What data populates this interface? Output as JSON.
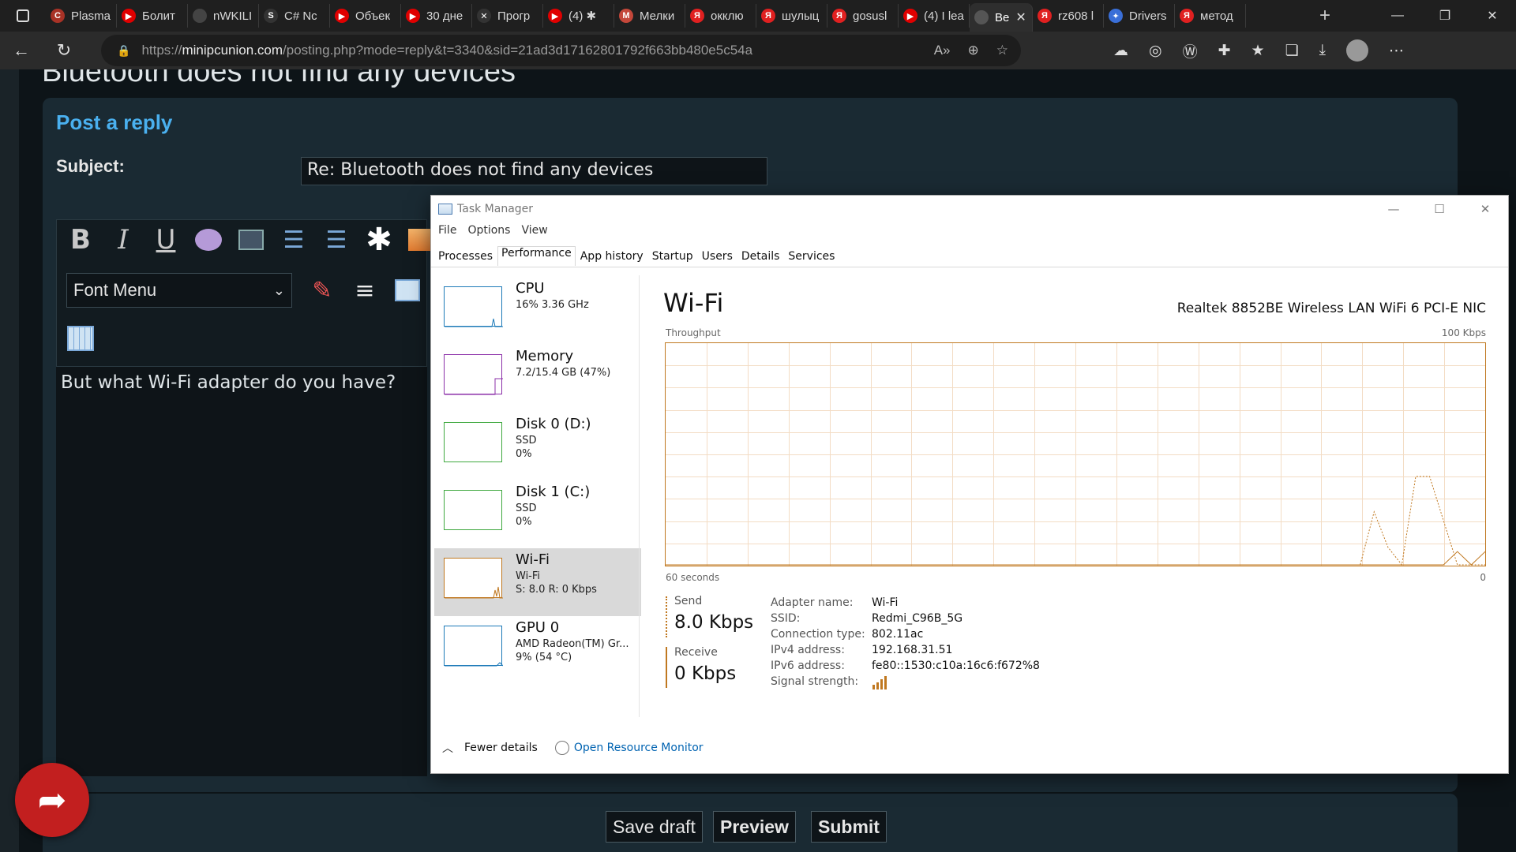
{
  "browser": {
    "tabs": [
      {
        "title": "Plasma",
        "color": "#a83226",
        "glyph": "C"
      },
      {
        "title": "Болит",
        "color": "#e00000",
        "glyph": "▶"
      },
      {
        "title": "nWKILI",
        "color": "#444444",
        "glyph": ""
      },
      {
        "title": "C# Nc",
        "color": "#333333",
        "glyph": "S"
      },
      {
        "title": "Объек",
        "color": "#e00000",
        "glyph": "▶"
      },
      {
        "title": "30 дне",
        "color": "#e00000",
        "glyph": "▶"
      },
      {
        "title": "Прогр",
        "color": "#333333",
        "glyph": "✕"
      },
      {
        "title": "(4) ✱",
        "color": "#e00000",
        "glyph": "▶"
      },
      {
        "title": "Мелки",
        "color": "#c4473a",
        "glyph": "M"
      },
      {
        "title": "окклю",
        "color": "#e02020",
        "glyph": "Я"
      },
      {
        "title": "шулыц",
        "color": "#e02020",
        "glyph": "Я"
      },
      {
        "title": "gosusl",
        "color": "#e02020",
        "glyph": "Я"
      },
      {
        "title": "(4) I lea",
        "color": "#e00000",
        "glyph": "▶"
      },
      {
        "title": "Be",
        "color": "#555555",
        "glyph": "",
        "active": true
      },
      {
        "title": "rz608 l",
        "color": "#e02020",
        "glyph": "Я"
      },
      {
        "title": "Drivers",
        "color": "#3a6fd8",
        "glyph": "✦"
      },
      {
        "title": "метод",
        "color": "#e02020",
        "glyph": "Я"
      }
    ],
    "url_prefix": "https://",
    "url_host": "minipcunion.com",
    "url_path": "/posting.php?mode=reply&t=3340&sid=21ad3d17162801792f663bb480e5c54a"
  },
  "forum": {
    "topic_title": "Bluetooth does not find any devices",
    "post_reply_heading": "Post a reply",
    "subject_label": "Subject:",
    "subject_value": "Re: Bluetooth does not find any devices",
    "toolbar": {
      "bold": "B",
      "italic": "I",
      "underline": "U"
    },
    "font_menu_label": "Font Menu",
    "message_text": "But what Wi-Fi adapter do you have?",
    "buttons": {
      "save_draft": "Save draft",
      "preview": "Preview",
      "submit": "Submit"
    }
  },
  "task_manager": {
    "title": "Task Manager",
    "menu": [
      "File",
      "Options",
      "View"
    ],
    "tabs": [
      "Processes",
      "Performance",
      "App history",
      "Startup",
      "Users",
      "Details",
      "Services"
    ],
    "active_tab": "Performance",
    "sidebar": [
      {
        "name": "CPU",
        "lines": [
          "16%  3.36 GHz"
        ],
        "color": "#1d7ab8"
      },
      {
        "name": "Memory",
        "lines": [
          "7.2/15.4 GB (47%)"
        ],
        "color": "#8b2fa8"
      },
      {
        "name": "Disk 0 (D:)",
        "lines": [
          "SSD",
          "0%"
        ],
        "color": "#3fa83f"
      },
      {
        "name": "Disk 1 (C:)",
        "lines": [
          "SSD",
          "0%"
        ],
        "color": "#3fa83f"
      },
      {
        "name": "Wi-Fi",
        "lines": [
          "Wi-Fi",
          "S: 8.0  R: 0 Kbps"
        ],
        "color": "#c07820",
        "selected": true
      },
      {
        "name": "GPU 0",
        "lines": [
          "AMD Radeon(TM) Gr...",
          "9%  (54 °C)"
        ],
        "color": "#1d7ab8"
      }
    ],
    "main": {
      "title": "Wi-Fi",
      "adapter": "Realtek 8852BE Wireless LAN WiFi 6 PCI-E NIC",
      "graph_label": "Throughput",
      "graph_max": "100 Kbps",
      "graph_time": "60 seconds",
      "graph_min": "0",
      "send_label": "Send",
      "send_value": "8.0 Kbps",
      "receive_label": "Receive",
      "receive_value": "0 Kbps",
      "details": [
        {
          "k": "Adapter name:",
          "v": "Wi-Fi"
        },
        {
          "k": "SSID:",
          "v": "Redmi_C96B_5G"
        },
        {
          "k": "Connection type:",
          "v": "802.11ac"
        },
        {
          "k": "IPv4 address:",
          "v": "192.168.31.51"
        },
        {
          "k": "IPv6 address:",
          "v": "fe80::1530:c10a:16c6:f672%8"
        },
        {
          "k": "Signal strength:",
          "v": ""
        }
      ]
    },
    "footer": {
      "fewer_details": "Fewer details",
      "resource_monitor": "Open Resource Monitor"
    },
    "throughput_send_kbps": [
      0,
      0,
      0,
      0,
      0,
      0,
      0,
      0,
      0,
      0,
      0,
      0,
      0,
      0,
      0,
      0,
      0,
      0,
      0,
      0,
      0,
      0,
      0,
      0,
      0,
      0,
      0,
      0,
      0,
      0,
      0,
      0,
      0,
      0,
      0,
      0,
      0,
      0,
      0,
      0,
      0,
      0,
      0,
      0,
      0,
      0,
      0,
      0,
      0,
      0,
      0,
      24,
      8,
      0,
      40,
      40,
      20,
      0,
      0,
      0
    ],
    "throughput_recv_kbps": [
      0,
      0,
      0,
      0,
      0,
      0,
      0,
      0,
      0,
      0,
      0,
      0,
      0,
      0,
      0,
      0,
      0,
      0,
      0,
      0,
      0,
      0,
      0,
      0,
      0,
      0,
      0,
      0,
      0,
      0,
      0,
      0,
      0,
      0,
      0,
      0,
      0,
      0,
      0,
      0,
      0,
      0,
      0,
      0,
      0,
      0,
      0,
      0,
      0,
      0,
      0,
      0,
      0,
      0,
      0,
      0,
      0,
      6,
      0,
      6
    ]
  }
}
